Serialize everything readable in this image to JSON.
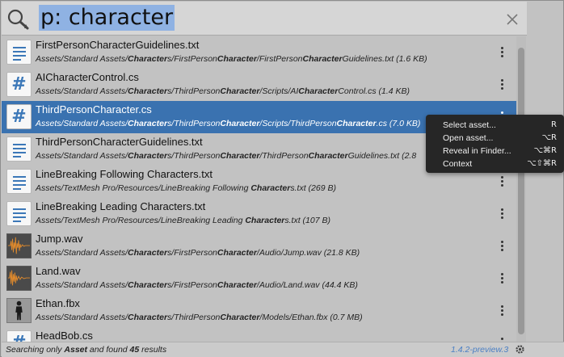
{
  "search": {
    "query": "p: character"
  },
  "results": [
    {
      "name": "FirstPersonCharacterGuidelines.txt",
      "icon": "text-file-icon",
      "path": [
        [
          "Assets/Standard Assets/",
          false
        ],
        [
          "Character",
          true
        ],
        [
          "s/FirstPerson",
          false
        ],
        [
          "Character",
          true
        ],
        [
          "/FirstPerson",
          false
        ],
        [
          "Character",
          true
        ],
        [
          "Guidelines.txt (1.6 KB)",
          false
        ]
      ]
    },
    {
      "name": "AICharacterControl.cs",
      "icon": "csharp-script-icon",
      "path": [
        [
          "Assets/Standard Assets/",
          false
        ],
        [
          "Character",
          true
        ],
        [
          "s/ThirdPerson",
          false
        ],
        [
          "Character",
          true
        ],
        [
          "/Scripts/AI",
          false
        ],
        [
          "Character",
          true
        ],
        [
          "Control.cs (1.4 KB)",
          false
        ]
      ]
    },
    {
      "name": "ThirdPersonCharacter.cs",
      "icon": "csharp-script-icon",
      "selected": true,
      "path": [
        [
          "Assets/Standard Assets/",
          false
        ],
        [
          "Character",
          true
        ],
        [
          "s/ThirdPerson",
          false
        ],
        [
          "Character",
          true
        ],
        [
          "/Scripts/ThirdPerson",
          false
        ],
        [
          "Character",
          true
        ],
        [
          ".cs (7.0 KB)",
          false
        ]
      ]
    },
    {
      "name": "ThirdPersonCharacterGuidelines.txt",
      "icon": "text-file-icon",
      "path": [
        [
          "Assets/Standard Assets/",
          false
        ],
        [
          "Character",
          true
        ],
        [
          "s/ThirdPerson",
          false
        ],
        [
          "Character",
          true
        ],
        [
          "/ThirdPerson",
          false
        ],
        [
          "Character",
          true
        ],
        [
          "Guidelines.txt (2.8",
          false
        ]
      ]
    },
    {
      "name": "LineBreaking Following Characters.txt",
      "icon": "text-file-icon",
      "path": [
        [
          "Assets/TextMesh Pro/Resources/LineBreaking Following ",
          false
        ],
        [
          "Character",
          true
        ],
        [
          "s.txt (269 B)",
          false
        ]
      ]
    },
    {
      "name": "LineBreaking Leading Characters.txt",
      "icon": "text-file-icon",
      "path": [
        [
          "Assets/TextMesh Pro/Resources/LineBreaking Leading ",
          false
        ],
        [
          "Character",
          true
        ],
        [
          "s.txt (107 B)",
          false
        ]
      ]
    },
    {
      "name": "Jump.wav",
      "icon": "audio-waveform-icon",
      "path": [
        [
          "Assets/Standard Assets/",
          false
        ],
        [
          "Character",
          true
        ],
        [
          "s/FirstPerson",
          false
        ],
        [
          "Character",
          true
        ],
        [
          "/Audio/Jump.wav (21.8 KB)",
          false
        ]
      ]
    },
    {
      "name": "Land.wav",
      "icon": "audio-waveform-icon",
      "path": [
        [
          "Assets/Standard Assets/",
          false
        ],
        [
          "Character",
          true
        ],
        [
          "s/FirstPerson",
          false
        ],
        [
          "Character",
          true
        ],
        [
          "/Audio/Land.wav (44.4 KB)",
          false
        ]
      ]
    },
    {
      "name": "Ethan.fbx",
      "icon": "model-fbx-icon",
      "path": [
        [
          "Assets/Standard Assets/",
          false
        ],
        [
          "Character",
          true
        ],
        [
          "s/ThirdPerson",
          false
        ],
        [
          "Character",
          true
        ],
        [
          "/Models/Ethan.fbx (0.7 MB)",
          false
        ]
      ]
    },
    {
      "name": "HeadBob.cs",
      "icon": "csharp-script-icon",
      "path": []
    }
  ],
  "context_menu": [
    {
      "label": "Select asset...",
      "shortcut": "R"
    },
    {
      "label": "Open asset...",
      "shortcut": "⌥R"
    },
    {
      "label": "Reveal in Finder...",
      "shortcut": "⌥⌘R"
    },
    {
      "label": "Context",
      "shortcut": "⌥⇧⌘R"
    }
  ],
  "status": {
    "prefix": "Searching only ",
    "provider": "Asset",
    "middle": " and found ",
    "count": "45",
    "suffix": " results",
    "version": "1.4.2-preview.3"
  },
  "colors": {
    "selection": "#3a72b0",
    "query_highlight": "#8fb2e3",
    "menu_bg": "#262626"
  }
}
